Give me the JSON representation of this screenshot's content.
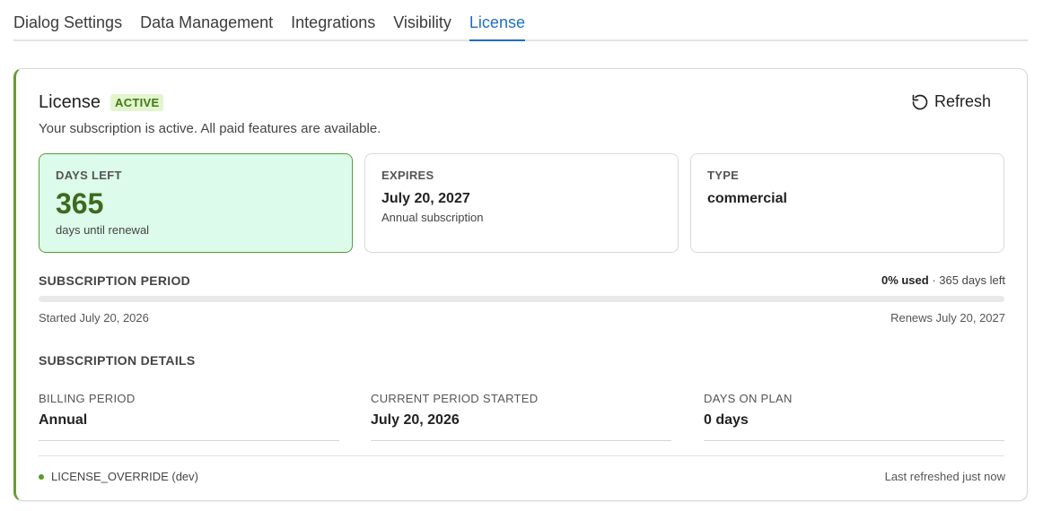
{
  "tabs": [
    {
      "label": "Dialog Settings",
      "active": false
    },
    {
      "label": "Data Management",
      "active": false
    },
    {
      "label": "Integrations",
      "active": false
    },
    {
      "label": "Visibility",
      "active": false
    },
    {
      "label": "License",
      "active": true
    }
  ],
  "license": {
    "title": "License",
    "status_badge": "ACTIVE",
    "subtitle": "Your subscription is active. All paid features are available.",
    "refresh_label": "Refresh"
  },
  "stats": {
    "days_left": {
      "label": "DAYS LEFT",
      "value": "365",
      "caption": "days until renewal"
    },
    "expires": {
      "label": "EXPIRES",
      "value": "July 20, 2027",
      "caption": "Annual subscription"
    },
    "type": {
      "label": "TYPE",
      "value": "commercial"
    }
  },
  "period": {
    "label": "SUBSCRIPTION PERIOD",
    "used_pct": "0% used",
    "separator": " · ",
    "days_left_text": "365 days left",
    "used_fraction": 0,
    "started": "Started July 20, 2026",
    "renews": "Renews July 20, 2027"
  },
  "details": {
    "label": "SUBSCRIPTION DETAILS",
    "billing_period": {
      "label": "BILLING PERIOD",
      "value": "Annual"
    },
    "current_period_started": {
      "label": "CURRENT PERIOD STARTED",
      "value": "July 20, 2026"
    },
    "days_on_plan": {
      "label": "DAYS ON PLAN",
      "value": "0 days"
    }
  },
  "footer": {
    "source": "LICENSE_OVERRIDE (dev)",
    "last_refreshed": "Last refreshed just now"
  },
  "colors": {
    "accent": "#1f6fc4",
    "success": "#6a9a3a",
    "badge_bg": "#e3f5cf",
    "stat_green_bg": "#dcfbea"
  }
}
